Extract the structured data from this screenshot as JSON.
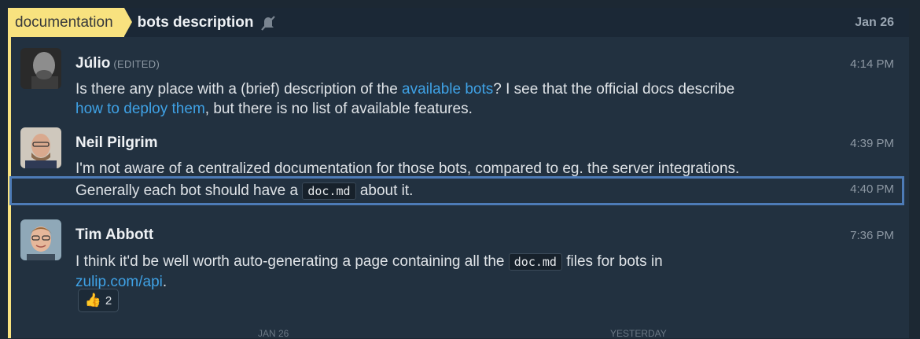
{
  "header": {
    "stream": "documentation",
    "topic": "bots description",
    "date": "Jan 26",
    "mute_icon": "muted-bell-icon"
  },
  "messages": [
    {
      "sender": "Júlio",
      "edited": "(EDITED)",
      "time": "4:14 PM",
      "line1_a": "Is there any place with a (brief) description of the ",
      "link1": "available bots",
      "line1_b": "? I see that the official docs describe",
      "link2": "how to deploy them",
      "line2_b": ", but there is no list of available features."
    },
    {
      "sender": "Neil Pilgrim",
      "time": "4:39 PM",
      "text": "I'm not aware of a centralized documentation for those bots, compared to eg. the server integrations."
    },
    {
      "time": "4:40 PM",
      "text_a": "Generally each bot should have a ",
      "code": "doc.md",
      "text_b": " about it."
    },
    {
      "sender": "Tim Abbott",
      "time": "7:36 PM",
      "line1_a": "I think it'd be well worth auto-generating a page containing all the ",
      "code": "doc.md",
      "line1_b": " files for bots in",
      "link": "zulip.com/api",
      "line2_b": ".",
      "reaction": {
        "emoji": "👍",
        "count": "2"
      }
    }
  ],
  "footer": {
    "left_date": "JAN 26",
    "right_date": "YESTERDAY"
  }
}
